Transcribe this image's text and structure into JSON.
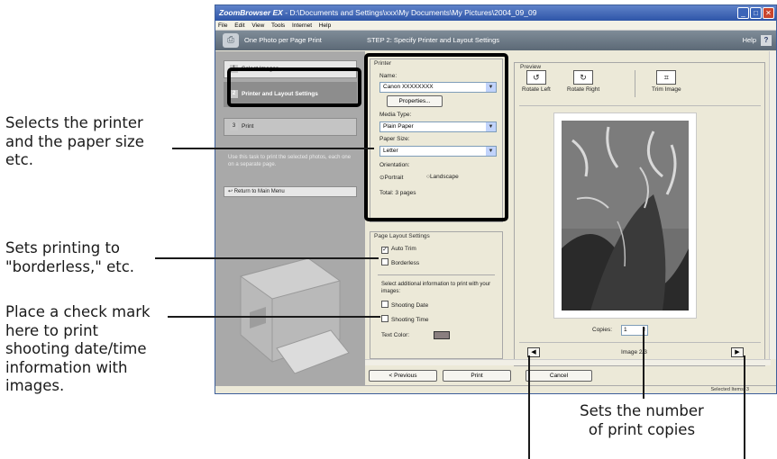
{
  "window": {
    "title_app": "ZoomBrowser EX",
    "title_path": " -  D:\\Documents and Settings\\xxx\\My Documents\\My Pictures\\2004_09_09",
    "menu": [
      "File",
      "Edit",
      "View",
      "Tools",
      "Internet",
      "Help"
    ],
    "task_title": "One Photo per Page Print",
    "step_title": "STEP 2: Specify Printer and Layout Settings",
    "help_label": "Help",
    "help_button": "?"
  },
  "left_pane": {
    "steps": [
      {
        "num": "1",
        "label": "Select Images"
      },
      {
        "num": "2",
        "label": "Printer and Layout Settings"
      },
      {
        "num": "3",
        "label": "Print"
      }
    ],
    "description": "Use this task to print the selected photos, each one on a separate page.",
    "return_button": "Return to Main Menu"
  },
  "printer_group": {
    "title": "Printer",
    "name_label": "Name:",
    "name_value": "Canon XXXXXXXX",
    "properties_button": "Properties...",
    "media_label": "Media Type:",
    "media_value": "Plain Paper",
    "paper_label": "Paper Size:",
    "paper_value": "Letter",
    "orientation_label": "Orientation:",
    "portrait": "Portrait",
    "landscape": "Landscape",
    "total": "Total: 3 pages"
  },
  "layout_group": {
    "title": "Page Layout Settings",
    "auto_trim": "Auto Trim",
    "borderless": "Borderless",
    "additional_info": "Select additional information to print with your images:",
    "shooting_date": "Shooting Date",
    "shooting_time": "Shooting Time",
    "text_color": "Text Color:"
  },
  "preview": {
    "title": "Preview",
    "rotate_left": "Rotate Left",
    "rotate_right": "Rotate Right",
    "trim_image": "Trim Image",
    "copies_label": "Copies:",
    "copies_value": "1",
    "image_counter": "Image 2/3"
  },
  "bottom_buttons": {
    "previous": "< Previous",
    "print": "Print",
    "cancel": "Cancel"
  },
  "status": {
    "selected_items": "Selected Items: 3"
  },
  "callouts": {
    "printer_line1": "Selects the printer",
    "printer_line2": "and the paper size",
    "printer_line3": "etc.",
    "borderless_line1": "Sets printing to",
    "borderless_line2": "\"borderless,\" etc.",
    "date_line1": "Place a check mark",
    "date_line2": "here to print",
    "date_line3": "shooting date/time",
    "date_line4": "information with",
    "date_line5": "images.",
    "copies_line1": "Sets the number",
    "copies_line2": "of print copies"
  },
  "colors": {
    "highlight": "#000000",
    "title_bar": "#2e55a8",
    "left_pane": "#a9a9a9"
  }
}
